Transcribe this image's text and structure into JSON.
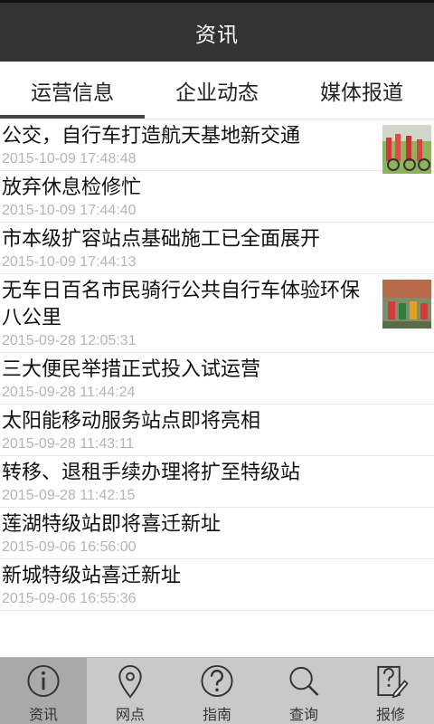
{
  "header": {
    "title": "资讯"
  },
  "tabs": [
    {
      "label": "运营信息",
      "active": true
    },
    {
      "label": "企业动态",
      "active": false
    },
    {
      "label": "媒体报道",
      "active": false
    }
  ],
  "news": [
    {
      "title": "公交，自行车打造航天基地新交通",
      "time": "2015-10-09 17:48:48",
      "has_thumb": true
    },
    {
      "title": "放弃休息检修忙",
      "time": "2015-10-09 17:44:40",
      "has_thumb": false
    },
    {
      "title": "市本级扩容站点基础施工已全面展开",
      "time": "2015-10-09 17:44:13",
      "has_thumb": false
    },
    {
      "title": "无车日百名市民骑行公共自行车体验环保八公里",
      "time": "2015-09-28 12:05:31",
      "has_thumb": true
    },
    {
      "title": "三大便民举措正式投入试运营",
      "time": "2015-09-28 11:44:24",
      "has_thumb": false
    },
    {
      "title": "太阳能移动服务站点即将亮相",
      "time": "2015-09-28 11:43:11",
      "has_thumb": false
    },
    {
      "title": "转移、退租手续办理将扩至特级站",
      "time": "2015-09-28 11:42:15",
      "has_thumb": false
    },
    {
      "title": "莲湖特级站即将喜迁新址",
      "time": "2015-09-06 16:56:00",
      "has_thumb": false
    },
    {
      "title": "新城特级站喜迁新址",
      "time": "2015-09-06 16:55:36",
      "has_thumb": false
    }
  ],
  "bottom_nav": [
    {
      "label": "资讯",
      "icon": "info-icon",
      "active": true
    },
    {
      "label": "网点",
      "icon": "location-pin-icon",
      "active": false
    },
    {
      "label": "指南",
      "icon": "question-icon",
      "active": false
    },
    {
      "label": "查询",
      "icon": "search-icon",
      "active": false
    },
    {
      "label": "报修",
      "icon": "repair-report-icon",
      "active": false
    }
  ],
  "colors": {
    "titlebar": "#333333",
    "bottom_nav": "#c9c9c9",
    "bottom_nav_active": "#a9a9a9",
    "time_text": "#b5b5b5"
  }
}
